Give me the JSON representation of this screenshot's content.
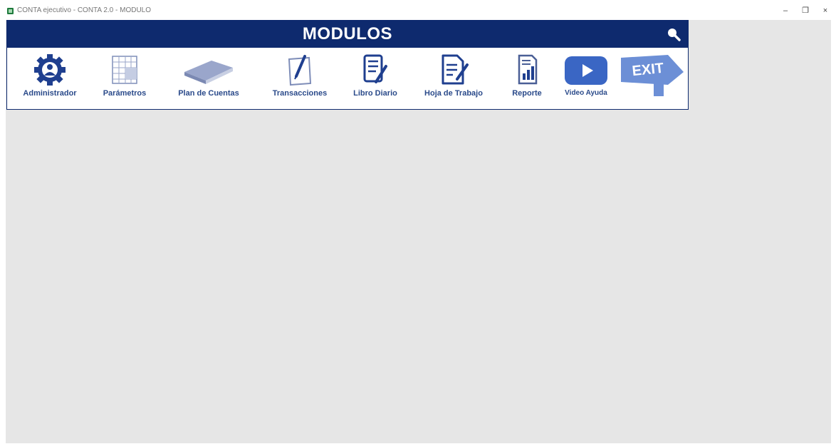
{
  "window": {
    "title": "CONTA ejecutivo - CONTA 2.0 - MODULO",
    "minimize": "–",
    "maximize": "❐",
    "close": "×"
  },
  "panel": {
    "title": "MODULOS",
    "header_color": "#0e2a6e"
  },
  "modules": [
    {
      "label": "Administrador",
      "icon": "gear-user-icon"
    },
    {
      "label": "Parámetros",
      "icon": "spreadsheet-icon"
    },
    {
      "label": "Plan de Cuentas",
      "icon": "book-icon"
    },
    {
      "label": "Transacciones",
      "icon": "notepad-pen-icon"
    },
    {
      "label": "Libro Diario",
      "icon": "ledger-icon"
    },
    {
      "label": "Hoja de Trabajo",
      "icon": "document-edit-icon"
    },
    {
      "label": "Reporte",
      "icon": "report-chart-icon"
    },
    {
      "label": "Video Ayuda",
      "icon": "play-video-icon"
    },
    {
      "label": "EXIT",
      "icon": "exit-sign-icon"
    }
  ]
}
